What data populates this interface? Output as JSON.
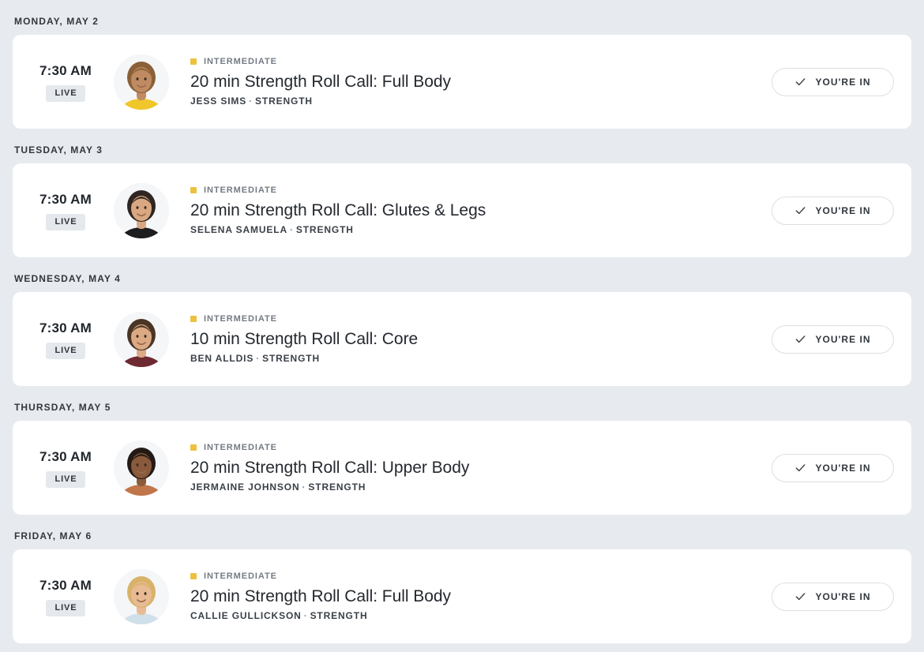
{
  "page": {
    "background_color": "#e7eaee",
    "card_color": "#ffffff",
    "difficulty_color": "#edc13f"
  },
  "days": [
    {
      "header": "MONDAY, MAY 2",
      "classes": [
        {
          "time": "7:30 AM",
          "live_label": "LIVE",
          "difficulty": "INTERMEDIATE",
          "title": "20 min Strength Roll Call: Full Body",
          "instructor": "JESS SIMS",
          "separator": "·",
          "discipline": "STRENGTH",
          "status_label": "YOU'RE IN",
          "status_icon": "check-icon",
          "avatar": "instructor-avatar-jess-sims"
        }
      ]
    },
    {
      "header": "TUESDAY, MAY 3",
      "classes": [
        {
          "time": "7:30 AM",
          "live_label": "LIVE",
          "difficulty": "INTERMEDIATE",
          "title": "20 min Strength Roll Call: Glutes & Legs",
          "instructor": "SELENA SAMUELA",
          "separator": "·",
          "discipline": "STRENGTH",
          "status_label": "YOU'RE IN",
          "status_icon": "check-icon",
          "avatar": "instructor-avatar-selena-samuela"
        }
      ]
    },
    {
      "header": "WEDNESDAY, MAY 4",
      "classes": [
        {
          "time": "7:30 AM",
          "live_label": "LIVE",
          "difficulty": "INTERMEDIATE",
          "title": "10 min Strength Roll Call: Core",
          "instructor": "BEN ALLDIS",
          "separator": "·",
          "discipline": "STRENGTH",
          "status_label": "YOU'RE IN",
          "status_icon": "check-icon",
          "avatar": "instructor-avatar-ben-alldis"
        }
      ]
    },
    {
      "header": "THURSDAY, MAY 5",
      "classes": [
        {
          "time": "7:30 AM",
          "live_label": "LIVE",
          "difficulty": "INTERMEDIATE",
          "title": "20 min Strength Roll Call: Upper Body",
          "instructor": "JERMAINE JOHNSON",
          "separator": "·",
          "discipline": "STRENGTH",
          "status_label": "YOU'RE IN",
          "status_icon": "check-icon",
          "avatar": "instructor-avatar-jermaine-johnson"
        }
      ]
    },
    {
      "header": "FRIDAY, MAY 6",
      "classes": [
        {
          "time": "7:30 AM",
          "live_label": "LIVE",
          "difficulty": "INTERMEDIATE",
          "title": "20 min Strength Roll Call: Full Body",
          "instructor": "CALLIE GULLICKSON",
          "separator": "·",
          "discipline": "STRENGTH",
          "status_label": "YOU'RE IN",
          "status_icon": "check-icon",
          "avatar": "instructor-avatar-callie-gullickson"
        }
      ]
    }
  ],
  "avatar_palettes": {
    "instructor-avatar-jess-sims": {
      "bg": "#f5f6f8",
      "hair": "#8a6038",
      "skin": "#c08b62",
      "top": "#f0c62a"
    },
    "instructor-avatar-selena-samuela": {
      "bg": "#f5f6f8",
      "hair": "#2f2622",
      "skin": "#d9a882",
      "top": "#1d1c1f"
    },
    "instructor-avatar-ben-alldis": {
      "bg": "#f5f6f8",
      "hair": "#4a3526",
      "skin": "#dba983",
      "top": "#6e2a31"
    },
    "instructor-avatar-jermaine-johnson": {
      "bg": "#f5f6f8",
      "hair": "#231a16",
      "skin": "#8a5a3c",
      "top": "#c0754a"
    },
    "instructor-avatar-callie-gullickson": {
      "bg": "#f5f6f8",
      "hair": "#d9b26a",
      "skin": "#e8bb94",
      "top": "#cfe0ea"
    }
  }
}
